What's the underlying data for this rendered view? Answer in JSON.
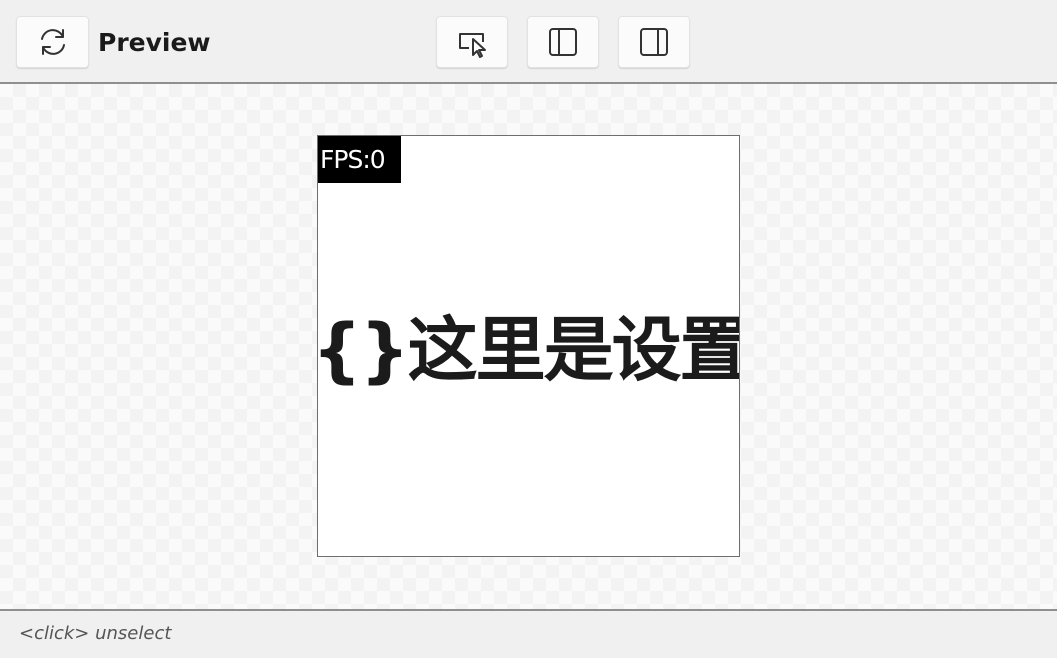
{
  "header": {
    "title": "Preview",
    "buttons": [
      {
        "name": "refresh",
        "icon": "refresh-icon"
      },
      {
        "name": "select",
        "icon": "select-cursor-icon"
      },
      {
        "name": "dock-left",
        "icon": "panel-left-icon"
      },
      {
        "name": "dock-right",
        "icon": "panel-right-icon"
      }
    ]
  },
  "preview": {
    "fps_label": "FPS:0",
    "content_text": "{}这里是设置文"
  },
  "status": {
    "hint": "<click> unselect"
  },
  "colors": {
    "toolbar_bg": "#f0f0f0",
    "canvas_bg": "#ffffff",
    "fps_bg": "#000000",
    "fps_text": "#ffffff",
    "content_text": "#1b1b1b"
  }
}
